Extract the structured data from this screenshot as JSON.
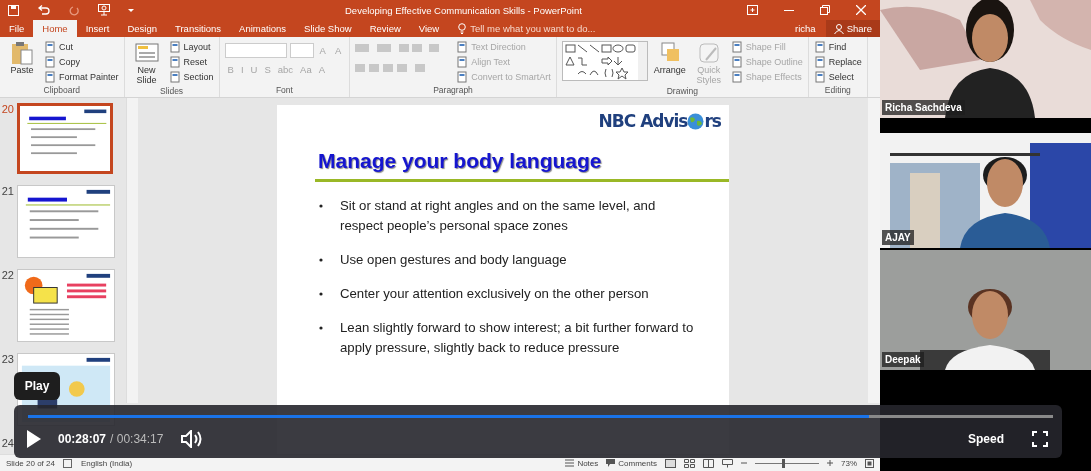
{
  "window": {
    "title": "Developing Effective Communication Skills - PowerPoint"
  },
  "tabs": [
    {
      "label": "File",
      "selected": false
    },
    {
      "label": "Home",
      "selected": true
    },
    {
      "label": "Insert",
      "selected": false
    },
    {
      "label": "Design",
      "selected": false
    },
    {
      "label": "Transitions",
      "selected": false
    },
    {
      "label": "Animations",
      "selected": false
    },
    {
      "label": "Slide Show",
      "selected": false
    },
    {
      "label": "Review",
      "selected": false
    },
    {
      "label": "View",
      "selected": false
    }
  ],
  "tell_me": {
    "placeholder": "Tell me what you want to do..."
  },
  "user": "richa",
  "share": "Share",
  "ribbon": {
    "groups": [
      {
        "label": "Clipboard",
        "kind": "standard",
        "commands": [
          {
            "label": "Paste",
            "kind": "large",
            "disabled": false
          },
          {
            "label": "Cut",
            "kind": "small",
            "disabled": false
          },
          {
            "label": "Copy",
            "kind": "small",
            "disabled": false
          },
          {
            "label": "Format Painter",
            "kind": "small",
            "disabled": false
          }
        ]
      },
      {
        "label": "Slides",
        "kind": "standard",
        "commands": [
          {
            "label": "New Slide",
            "kind": "large",
            "disabled": false
          },
          {
            "label": "Layout",
            "kind": "small",
            "disabled": false
          },
          {
            "label": "Reset",
            "kind": "small",
            "disabled": false
          },
          {
            "label": "Section",
            "kind": "small",
            "disabled": false
          }
        ]
      },
      {
        "label": "Font",
        "kind": "font",
        "row1": [
          "A",
          "A"
        ],
        "row2": [
          "B",
          "I",
          "U",
          "S",
          "abc",
          "Aa",
          "A"
        ]
      },
      {
        "label": "Paragraph",
        "kind": "paragraph",
        "commands": [
          {
            "label": "Text Direction",
            "kind": "small",
            "disabled": true
          },
          {
            "label": "Align Text",
            "kind": "small",
            "disabled": true
          },
          {
            "label": "Convert to SmartArt",
            "kind": "small",
            "disabled": true
          }
        ]
      },
      {
        "label": "Drawing",
        "kind": "drawing",
        "commands": [
          {
            "label": "Arrange",
            "kind": "large",
            "disabled": false
          },
          {
            "label": "Quick Styles",
            "kind": "large",
            "disabled": true
          },
          {
            "label": "Shape Fill",
            "kind": "small",
            "disabled": true
          },
          {
            "label": "Shape Outline",
            "kind": "small",
            "disabled": true
          },
          {
            "label": "Shape Effects",
            "kind": "small",
            "disabled": true
          }
        ]
      },
      {
        "label": "Editing",
        "kind": "standard",
        "commands": [
          {
            "label": "Find",
            "kind": "small",
            "disabled": false
          },
          {
            "label": "Replace",
            "kind": "small",
            "disabled": false
          },
          {
            "label": "Select",
            "kind": "small",
            "disabled": false
          }
        ]
      }
    ]
  },
  "thumbnails": [
    {
      "number": "20",
      "selected": true
    },
    {
      "number": "21",
      "selected": false
    },
    {
      "number": "22",
      "selected": false
    },
    {
      "number": "23",
      "selected": false
    },
    {
      "number": "24",
      "selected": false
    }
  ],
  "slide": {
    "logo_before": "NBC Advis",
    "logo_after": "rs",
    "title": "Manage your body language",
    "bullets": [
      [
        "Sit or stand at right angles and on the same level, and",
        "respect people’s personal space zones"
      ],
      [
        "Use open gestures and body language"
      ],
      [
        "Center your attention exclusively on the other person"
      ],
      [
        "Lean slightly forward to show interest; a bit further forward to",
        "apply pressure, slightly back to reduce pressure"
      ]
    ]
  },
  "status_bar": {
    "slide": "Slide 20 of 24",
    "language": "English (India)",
    "notes": "Notes",
    "comments": "Comments",
    "zoom": "73%",
    "zoom_slider": {
      "level": 0.45
    }
  },
  "participants": [
    {
      "name": "Richa Sachdeva"
    },
    {
      "name": "AJAY"
    },
    {
      "name": "Deepak"
    }
  ],
  "player": {
    "tooltip": "Play",
    "current": "00:28:07",
    "total": "/ 00:34:17",
    "speed": "Speed",
    "level": 0.82
  }
}
